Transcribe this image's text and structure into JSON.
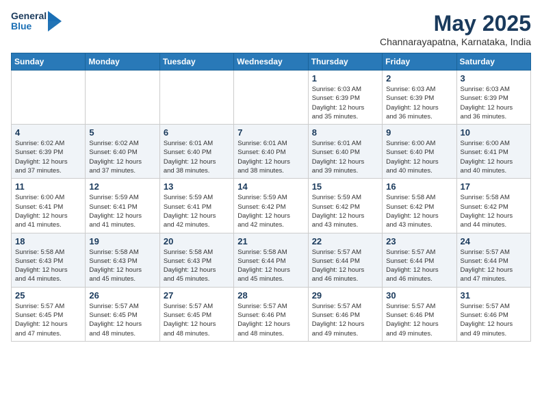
{
  "header": {
    "logo_line1": "General",
    "logo_line2": "Blue",
    "month": "May 2025",
    "location": "Channarayapatna, Karnataka, India"
  },
  "weekdays": [
    "Sunday",
    "Monday",
    "Tuesday",
    "Wednesday",
    "Thursday",
    "Friday",
    "Saturday"
  ],
  "weeks": [
    [
      {
        "day": "",
        "info": ""
      },
      {
        "day": "",
        "info": ""
      },
      {
        "day": "",
        "info": ""
      },
      {
        "day": "",
        "info": ""
      },
      {
        "day": "1",
        "info": "Sunrise: 6:03 AM\nSunset: 6:39 PM\nDaylight: 12 hours\nand 35 minutes."
      },
      {
        "day": "2",
        "info": "Sunrise: 6:03 AM\nSunset: 6:39 PM\nDaylight: 12 hours\nand 36 minutes."
      },
      {
        "day": "3",
        "info": "Sunrise: 6:03 AM\nSunset: 6:39 PM\nDaylight: 12 hours\nand 36 minutes."
      }
    ],
    [
      {
        "day": "4",
        "info": "Sunrise: 6:02 AM\nSunset: 6:39 PM\nDaylight: 12 hours\nand 37 minutes."
      },
      {
        "day": "5",
        "info": "Sunrise: 6:02 AM\nSunset: 6:40 PM\nDaylight: 12 hours\nand 37 minutes."
      },
      {
        "day": "6",
        "info": "Sunrise: 6:01 AM\nSunset: 6:40 PM\nDaylight: 12 hours\nand 38 minutes."
      },
      {
        "day": "7",
        "info": "Sunrise: 6:01 AM\nSunset: 6:40 PM\nDaylight: 12 hours\nand 38 minutes."
      },
      {
        "day": "8",
        "info": "Sunrise: 6:01 AM\nSunset: 6:40 PM\nDaylight: 12 hours\nand 39 minutes."
      },
      {
        "day": "9",
        "info": "Sunrise: 6:00 AM\nSunset: 6:40 PM\nDaylight: 12 hours\nand 40 minutes."
      },
      {
        "day": "10",
        "info": "Sunrise: 6:00 AM\nSunset: 6:41 PM\nDaylight: 12 hours\nand 40 minutes."
      }
    ],
    [
      {
        "day": "11",
        "info": "Sunrise: 6:00 AM\nSunset: 6:41 PM\nDaylight: 12 hours\nand 41 minutes."
      },
      {
        "day": "12",
        "info": "Sunrise: 5:59 AM\nSunset: 6:41 PM\nDaylight: 12 hours\nand 41 minutes."
      },
      {
        "day": "13",
        "info": "Sunrise: 5:59 AM\nSunset: 6:41 PM\nDaylight: 12 hours\nand 42 minutes."
      },
      {
        "day": "14",
        "info": "Sunrise: 5:59 AM\nSunset: 6:42 PM\nDaylight: 12 hours\nand 42 minutes."
      },
      {
        "day": "15",
        "info": "Sunrise: 5:59 AM\nSunset: 6:42 PM\nDaylight: 12 hours\nand 43 minutes."
      },
      {
        "day": "16",
        "info": "Sunrise: 5:58 AM\nSunset: 6:42 PM\nDaylight: 12 hours\nand 43 minutes."
      },
      {
        "day": "17",
        "info": "Sunrise: 5:58 AM\nSunset: 6:42 PM\nDaylight: 12 hours\nand 44 minutes."
      }
    ],
    [
      {
        "day": "18",
        "info": "Sunrise: 5:58 AM\nSunset: 6:43 PM\nDaylight: 12 hours\nand 44 minutes."
      },
      {
        "day": "19",
        "info": "Sunrise: 5:58 AM\nSunset: 6:43 PM\nDaylight: 12 hours\nand 45 minutes."
      },
      {
        "day": "20",
        "info": "Sunrise: 5:58 AM\nSunset: 6:43 PM\nDaylight: 12 hours\nand 45 minutes."
      },
      {
        "day": "21",
        "info": "Sunrise: 5:58 AM\nSunset: 6:44 PM\nDaylight: 12 hours\nand 45 minutes."
      },
      {
        "day": "22",
        "info": "Sunrise: 5:57 AM\nSunset: 6:44 PM\nDaylight: 12 hours\nand 46 minutes."
      },
      {
        "day": "23",
        "info": "Sunrise: 5:57 AM\nSunset: 6:44 PM\nDaylight: 12 hours\nand 46 minutes."
      },
      {
        "day": "24",
        "info": "Sunrise: 5:57 AM\nSunset: 6:44 PM\nDaylight: 12 hours\nand 47 minutes."
      }
    ],
    [
      {
        "day": "25",
        "info": "Sunrise: 5:57 AM\nSunset: 6:45 PM\nDaylight: 12 hours\nand 47 minutes."
      },
      {
        "day": "26",
        "info": "Sunrise: 5:57 AM\nSunset: 6:45 PM\nDaylight: 12 hours\nand 48 minutes."
      },
      {
        "day": "27",
        "info": "Sunrise: 5:57 AM\nSunset: 6:45 PM\nDaylight: 12 hours\nand 48 minutes."
      },
      {
        "day": "28",
        "info": "Sunrise: 5:57 AM\nSunset: 6:46 PM\nDaylight: 12 hours\nand 48 minutes."
      },
      {
        "day": "29",
        "info": "Sunrise: 5:57 AM\nSunset: 6:46 PM\nDaylight: 12 hours\nand 49 minutes."
      },
      {
        "day": "30",
        "info": "Sunrise: 5:57 AM\nSunset: 6:46 PM\nDaylight: 12 hours\nand 49 minutes."
      },
      {
        "day": "31",
        "info": "Sunrise: 5:57 AM\nSunset: 6:46 PM\nDaylight: 12 hours\nand 49 minutes."
      }
    ]
  ]
}
